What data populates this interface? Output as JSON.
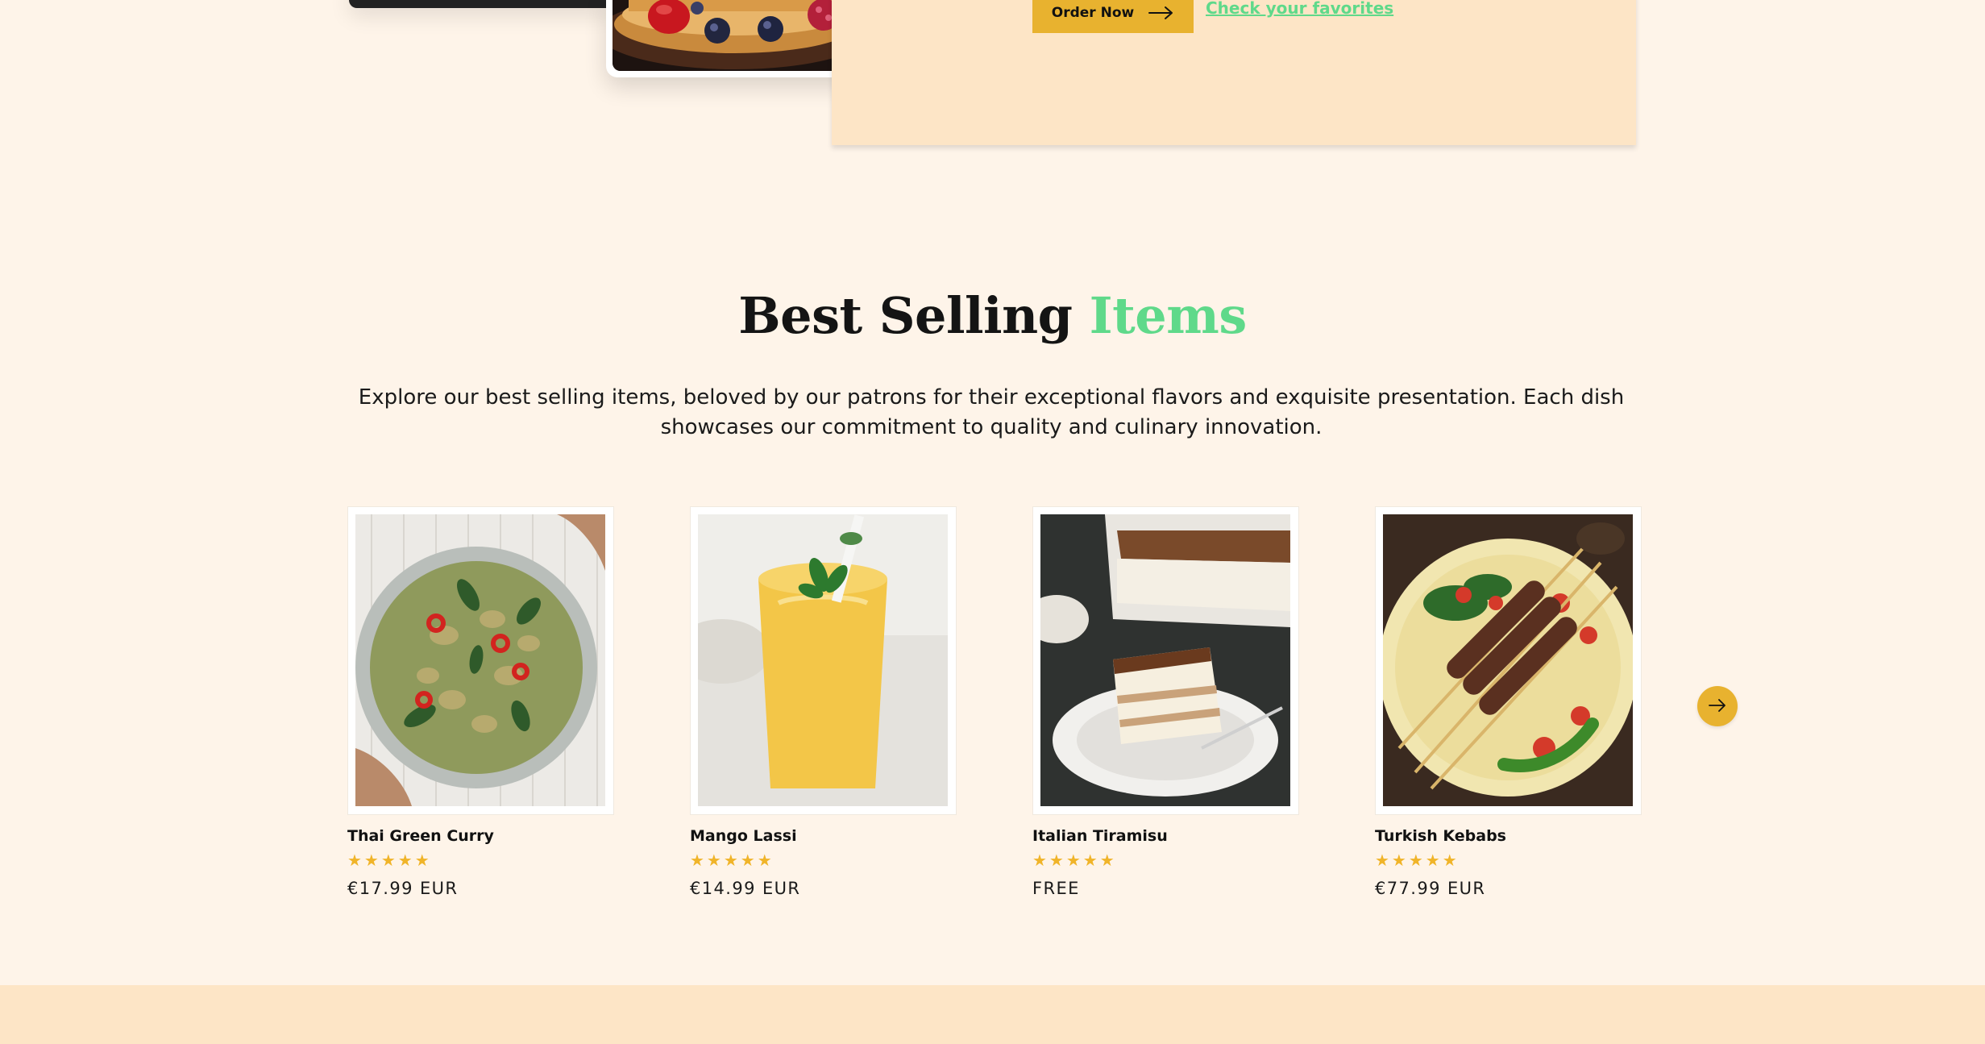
{
  "hero": {
    "order_button_label": "Order Now",
    "favorites_link": "Check your favorites"
  },
  "best_selling": {
    "title_main": "Best Selling",
    "title_accent": "Items",
    "description": "Explore our best selling items, beloved by our patrons for their exceptional flavors and exquisite presentation. Each dish showcases our commitment to quality and culinary innovation.",
    "items": [
      {
        "name": "Thai Green Curry",
        "rating": 5,
        "stars": "★★★★★",
        "price": "€17.99 EUR"
      },
      {
        "name": "Mango Lassi",
        "rating": 5,
        "stars": "★★★★★",
        "price": "€14.99 EUR"
      },
      {
        "name": "Italian Tiramisu",
        "rating": 5,
        "stars": "★★★★★",
        "price": "FREE"
      },
      {
        "name": "Turkish Kebabs",
        "rating": 5,
        "stars": "★★★★★",
        "price": "€77.99 EUR"
      }
    ]
  },
  "icons": {
    "order_arrow": "arrow-right-icon",
    "carousel_next": "arrow-right-icon"
  },
  "colors": {
    "page_background": "#fef4e9",
    "panel_background": "#fde5c6",
    "primary_button": "#e8b22f",
    "accent_green": "#5fd98a",
    "star": "#f0b429"
  }
}
